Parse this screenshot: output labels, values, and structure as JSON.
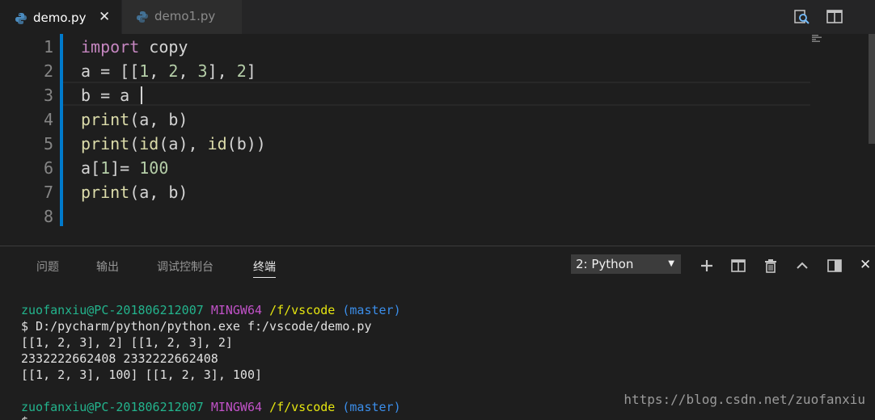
{
  "tabs": [
    {
      "label": "demo.py",
      "active": true,
      "close_glyph": "✕"
    },
    {
      "label": "demo1.py",
      "active": false
    }
  ],
  "tabbar_actions": [
    "find-in-files-icon",
    "split-editor-icon"
  ],
  "editor": {
    "line_numbers": [
      "1",
      "2",
      "3",
      "4",
      "5",
      "6",
      "7",
      "8"
    ],
    "cursor_line": 3,
    "lines": {
      "l1": {
        "kw": "import",
        "rest": " copy"
      },
      "l2": {
        "p1": "a = [[",
        "n1": "1",
        "p2": ", ",
        "n2": "2",
        "p3": ", ",
        "n3": "3",
        "p4": "], ",
        "n4": "2",
        "p5": "]"
      },
      "l3": {
        "text": "b = a "
      },
      "l4": {
        "fn": "print",
        "rest": "(a, b)"
      },
      "l5": {
        "fn1": "print",
        "p1": "(",
        "fn2": "id",
        "p2": "(a), ",
        "fn3": "id",
        "p3": "(b))"
      },
      "l6": {
        "p1": "a[",
        "n1": "1",
        "p2": "]= ",
        "n2": "100"
      },
      "l7": {
        "fn": "print",
        "rest": "(a, b)"
      }
    }
  },
  "panel": {
    "tabs": [
      "问题",
      "输出",
      "调试控制台",
      "终端"
    ],
    "active_tab": "终端",
    "terminal_select": "2: Python",
    "actions": [
      "plus-icon",
      "split-terminal-icon",
      "trash-icon",
      "chevron-up-icon",
      "maximize-panel-icon",
      "close-icon"
    ],
    "close_glyph": "✕",
    "prompt": {
      "user": "zuofanxiu@PC-201806212007",
      "env": "MINGW64",
      "path": "/f/vscode",
      "branch": "(master)"
    },
    "command": "$ D:/pycharm/python/python.exe f:/vscode/demo.py",
    "output": [
      "[[1, 2, 3], 2] [[1, 2, 3], 2]",
      "2332222662408 2332222662408",
      "[[1, 2, 3], 100] [[1, 2, 3], 100]"
    ],
    "last_prompt_char": "$"
  },
  "watermark": "https://blog.csdn.net/zuofanxiu",
  "colors": {
    "accent": "#007acc",
    "keyword": "#c586c0",
    "function": "#dcdcaa",
    "number": "#b5cea8",
    "term_user": "#23b48d",
    "term_env": "#c152c8",
    "term_path": "#e5e510",
    "term_branch": "#3b8eea"
  }
}
